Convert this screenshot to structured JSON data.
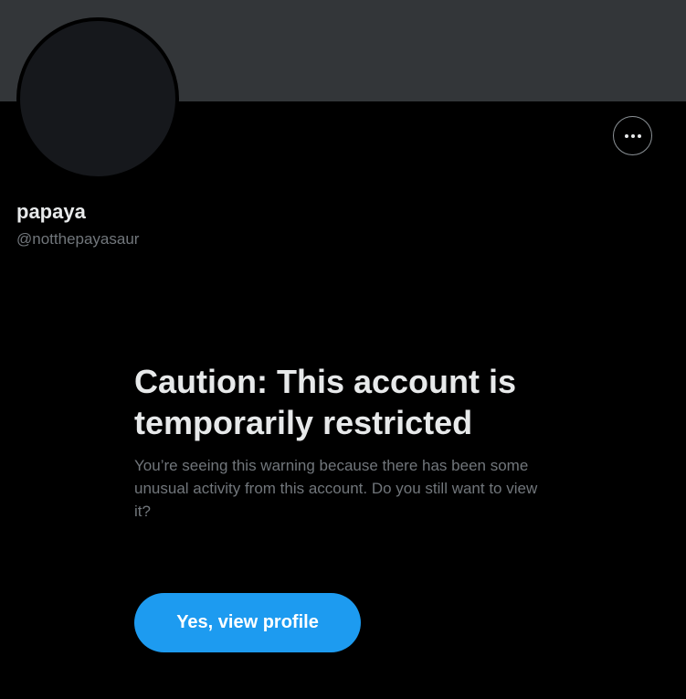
{
  "profile": {
    "display_name": "papaya",
    "handle": "@notthepayasaur",
    "more_icon": "more-horizontal-icon"
  },
  "warning": {
    "title": "Caution: This account is temporarily restricted",
    "body": "You’re seeing this warning because there has been some unusual activity from this account. Do you still want to view it?",
    "button_label": "Yes, view profile"
  },
  "colors": {
    "background": "#000000",
    "banner": "#333639",
    "avatar": "#16181c",
    "primary_text": "#e7e9ea",
    "secondary_text": "#71767b",
    "accent": "#1d9bf0"
  }
}
